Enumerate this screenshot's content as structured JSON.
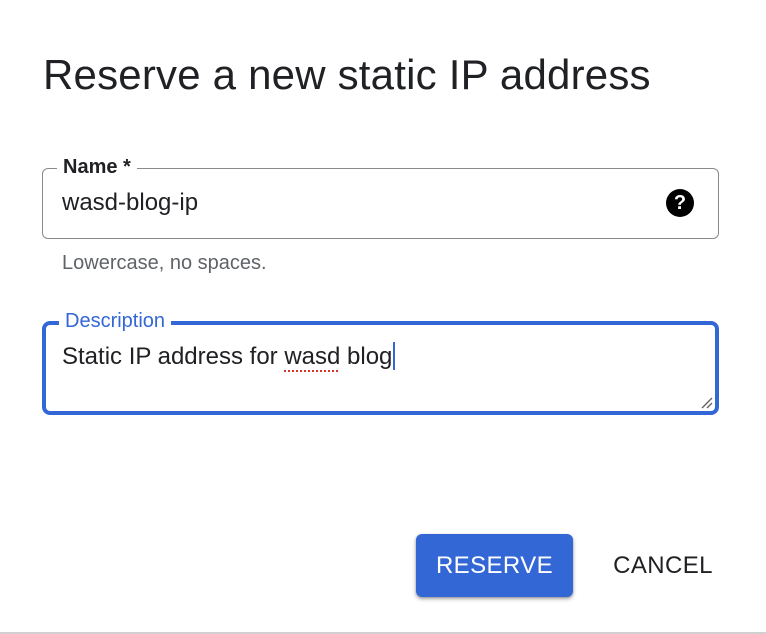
{
  "dialog": {
    "title": "Reserve a new static IP address"
  },
  "name_field": {
    "label": "Name *",
    "value": "wasd-blog-ip",
    "helper": "Lowercase, no spaces.",
    "help_icon": "help-circle-icon"
  },
  "description_field": {
    "label": "Description",
    "value_before": "Static IP address for ",
    "value_misspelled": "wasd",
    "value_after": " blog",
    "focused": true
  },
  "actions": {
    "reserve_label": "RESERVE",
    "cancel_label": "CANCEL"
  },
  "colors": {
    "accent": "#3367d6",
    "text": "#202124",
    "helper": "#5f6368",
    "border": "#8a8a8a",
    "spellcheck": "#d93025"
  }
}
